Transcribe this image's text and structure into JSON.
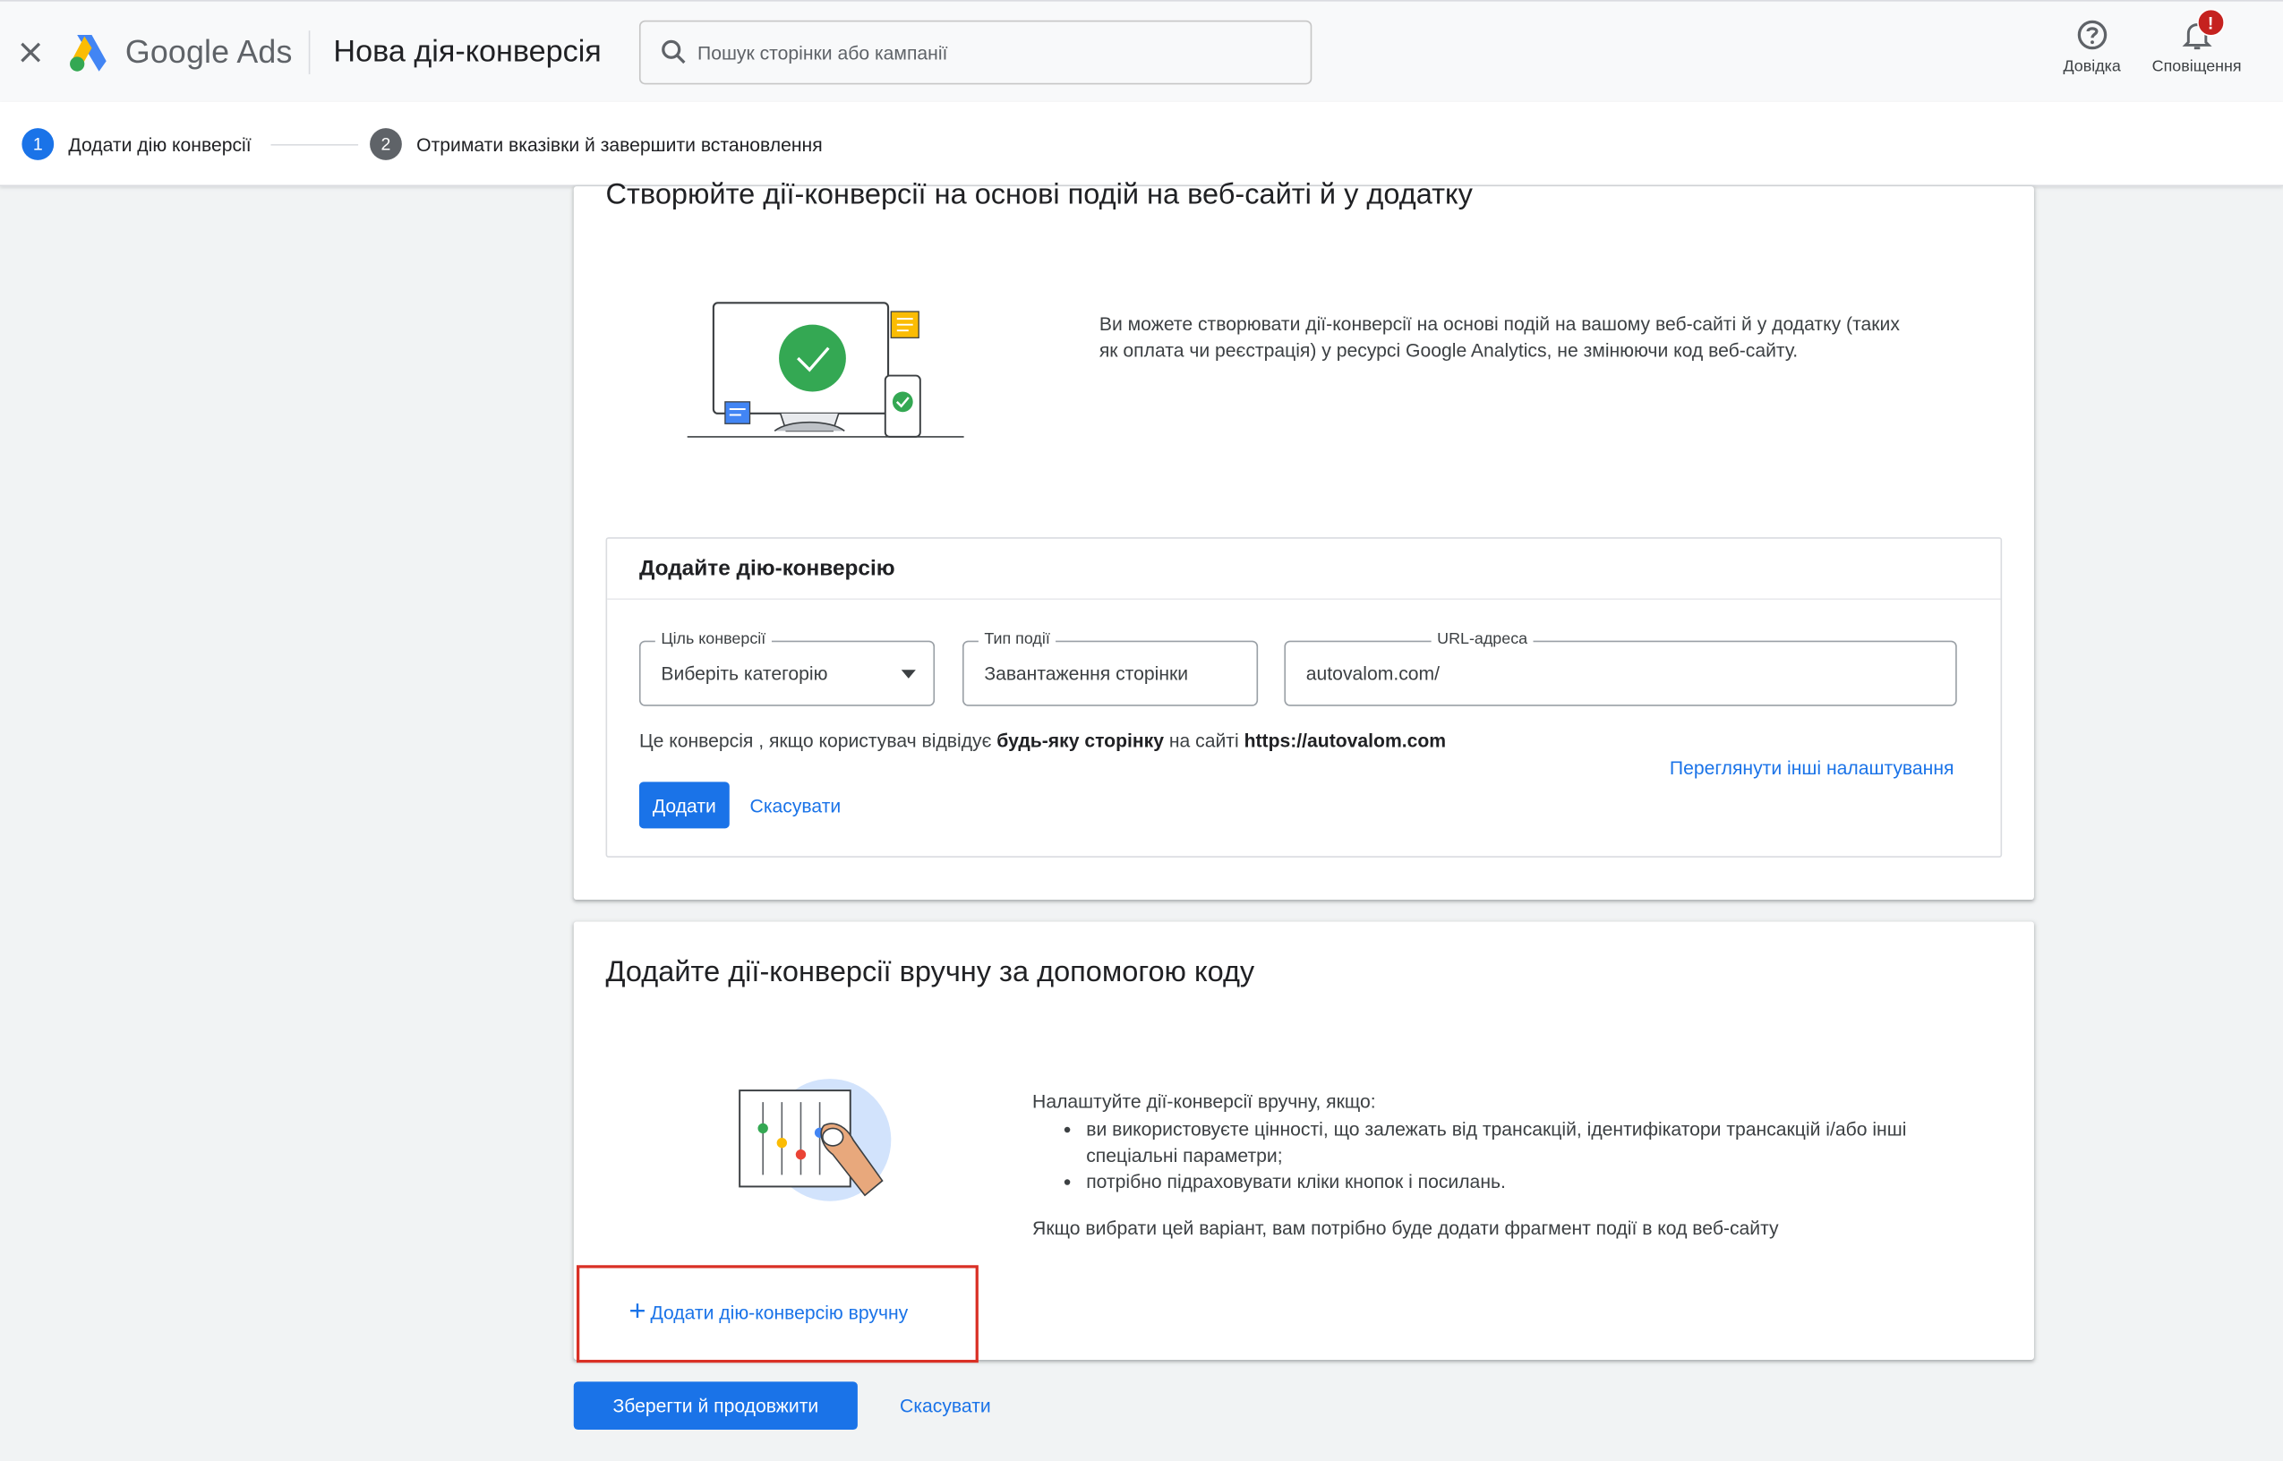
{
  "header": {
    "brand_google": "Google",
    "brand_ads": "Ads",
    "page_title": "Нова дія-конверсія",
    "search_placeholder": "Пошук сторінки або кампанії",
    "help_label": "Довідка",
    "notifications_label": "Сповіщення",
    "notifications_badge": "!"
  },
  "stepper": {
    "steps": [
      {
        "num": "1",
        "label": "Додати дію конверсії"
      },
      {
        "num": "2",
        "label": "Отримати вказівки й завершити встановлення"
      }
    ]
  },
  "card_events": {
    "title": "Створюйте дії-конверсії на основі подій на веб-сайті й у додатку",
    "description": "Ви можете створювати дії-конверсії на основі подій на вашому веб-сайті й у додатку (таких як оплата чи реєстрація) у ресурсі Google Analytics, не змінюючи код веб-сайту.",
    "form": {
      "heading": "Додайте дію-конверсію",
      "goal_label": "Ціль конверсії",
      "goal_value": "Виберіть категорію",
      "event_label": "Тип події",
      "event_value": "Завантаження сторінки",
      "url_label": "URL-адреса",
      "url_value": "autovalom.com/",
      "note_prefix": "Це конверсія , якщо користувач відвідує ",
      "note_bold": "будь-яку сторінку",
      "note_middle": " на сайті ",
      "note_site": "https://autovalom.com",
      "more_settings": "Переглянути інші налаштування",
      "add_button": "Додати",
      "cancel_button": "Скасувати"
    }
  },
  "card_manual": {
    "title": "Додайте дії-конверсії вручну за допомогою коду",
    "intro": "Налаштуйте дії-конверсії вручну, якщо:",
    "bullets": [
      "ви використовуєте цінності, що залежать від трансакцій, ідентифікатори трансакцій і/або інші спеціальні параметри;",
      "потрібно підраховувати кліки кнопок і посилань."
    ],
    "after": "Якщо вибрати цей варіант, вам потрібно буде додати фрагмент події в код веб-сайту",
    "add_manual_button": "Додати дію-конверсію вручну"
  },
  "footer": {
    "save_button": "Зберегти й продовжити",
    "cancel_button": "Скасувати"
  },
  "colors": {
    "accent": "#1a73e8",
    "highlight_border": "#d93025",
    "badge": "#c5221f"
  }
}
